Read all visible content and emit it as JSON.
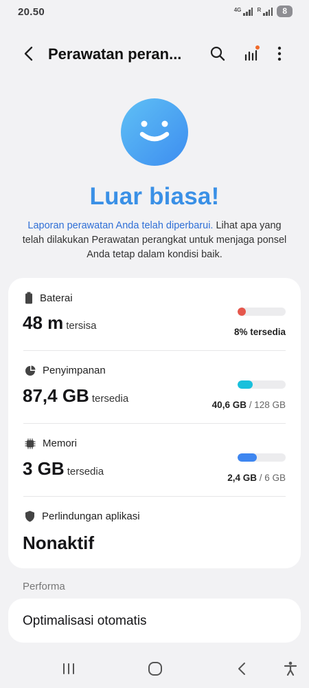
{
  "status": {
    "time": "20.50",
    "net1": "4G",
    "net2": "R",
    "battery": "8"
  },
  "appbar": {
    "title": "Perawatan peran..."
  },
  "hero": {
    "headline": "Luar biasa!",
    "link_text": "Laporan perawatan Anda telah diperbarui.",
    "body_text": " Lihat apa yang telah dilakukan Perawatan perangkat untuk menjaga ponsel Anda tetap dalam kondisi baik."
  },
  "items": {
    "battery": {
      "label": "Baterai",
      "value": "48 m",
      "unit": "tersisa",
      "caption_value": "8% tersedia",
      "level": 0.08,
      "color": "#e5574c"
    },
    "storage": {
      "label": "Penyimpanan",
      "value": "87,4 GB",
      "unit": "tersedia",
      "caption_value": "40,6 GB",
      "caption_total": " / 128 GB",
      "level": 0.317,
      "color": "#19c0dc"
    },
    "memory": {
      "label": "Memori",
      "value": "3 GB",
      "unit": "tersedia",
      "caption_value": "2,4 GB",
      "caption_total": " / 6 GB",
      "level": 0.4,
      "color": "#3e86f0"
    },
    "app_protection": {
      "label": "Perlindungan aplikasi",
      "value": "Nonaktif"
    }
  },
  "performance": {
    "section_label": "Performa",
    "auto_optimize": "Optimalisasi otomatis"
  },
  "icons": [
    "back-arrow-icon",
    "search-icon",
    "activity-chart-icon",
    "more-vert-icon",
    "battery-icon",
    "storage-pie-icon",
    "memory-chip-icon",
    "shield-icon",
    "recents-icon",
    "home-icon",
    "nav-back-icon",
    "accessibility-icon"
  ]
}
